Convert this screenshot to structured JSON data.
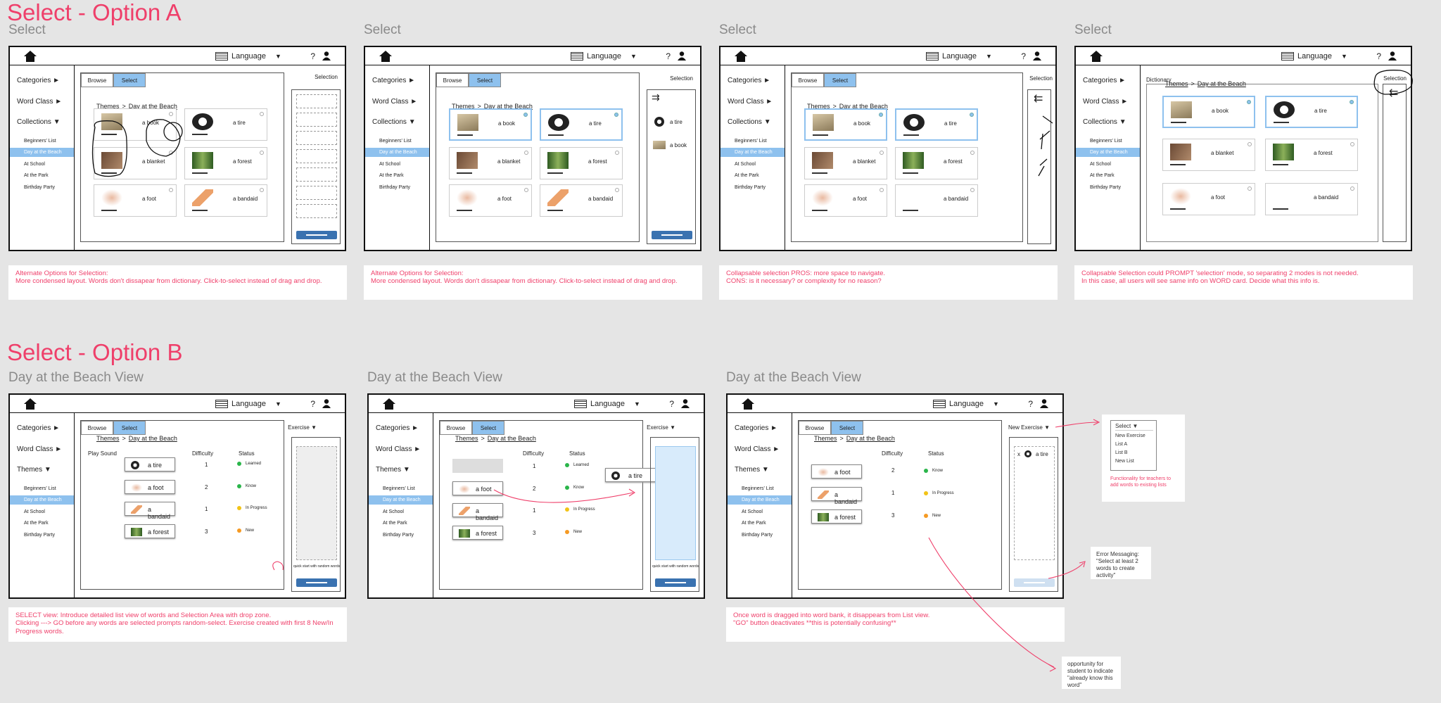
{
  "headings": {
    "a": "Select - Option A",
    "b": "Select - Option B"
  },
  "frame_labels": [
    "Select",
    "Select",
    "Select",
    "Select",
    "Day at the Beach View",
    "Day at the Beach View",
    "Day at the Beach View"
  ],
  "header": {
    "language": "Language",
    "help": "?"
  },
  "sidebar": {
    "categories": "Categories",
    "word_class": "Word Class",
    "collections": "Collections",
    "themes": "Themes",
    "items": [
      "Beginners' List",
      "Day at the Beach",
      "At School",
      "At the Park",
      "Birthday Party"
    ]
  },
  "tabs": {
    "browse": "Browse",
    "select": "Select"
  },
  "crumb": {
    "themes": "Themes",
    "sep": ">",
    "page": "Day at the Beach"
  },
  "words": {
    "book": "a book",
    "tire": "a tire",
    "blanket": "a blanket",
    "forest": "a forest",
    "foot": "a foot",
    "bandaid": "a bandaid"
  },
  "selection": "Selection",
  "dictionary": "Dictionary",
  "list": {
    "play_sound": "Play Sound",
    "difficulty": "Difficulty",
    "status": "Status",
    "exercise": "Exercise",
    "new_exercise": "New Exercise",
    "quick_start": "quick start with random words",
    "x": "x"
  },
  "diff": {
    "tire": "1",
    "foot": "2",
    "bandaid": "1",
    "forest": "3"
  },
  "status": {
    "learned": "Learned",
    "know": "Know",
    "in_progress": "In Progress",
    "new": "New"
  },
  "b3_diff": {
    "foot": "2",
    "bandaid": "1",
    "forest": "3"
  },
  "notes": [
    {
      "title": "Alternate Options for Selection:",
      "body": "More condensed layout. Words don't dissapear from dictionary. Click-to-select instead of drag and drop."
    },
    {
      "title": "Alternate Options for Selection:",
      "body": "More condensed layout. Words don't dissapear from dictionary. Click-to-select instead of drag and drop."
    },
    {
      "title": "Collapsable selection PROS: more space to navigate.",
      "body": "CONS: is it necessary? or complexity for no reason?"
    },
    {
      "title": "Collapsable Selection could PROMPT 'selection' mode, so separating 2 modes is not needed.",
      "body": "In this case, all users will see same info on WORD card. Decide what this info is."
    },
    {
      "title": "SELECT view: Introduce detailed list view of words and Selection Area with drop zone.",
      "body": "Clicking ---> GO before any words are selected prompts random-select. Exercise created with first 8 New/In Progress words."
    },
    {
      "title": "Once word is dragged into word bank, it disappears from List view.",
      "body": "\"GO\" button deactivates **this is potentially confusing**"
    }
  ],
  "dropdown": {
    "head": "Select",
    "items": [
      "New Exercise",
      "List A",
      "List B",
      "New List"
    ],
    "caption": "Functionality for teachers to add words to existing lists"
  },
  "error_msg": "Error Messaging: \"Select at least 2 words to create activity\"",
  "opportunity": "opportunity for student to indicate \"already know this word\"",
  "colors": {
    "accent": "#ef3f6a",
    "select_blue": "#8ec1ee",
    "go_blue": "#3a72b0",
    "learned": "#2ab54a",
    "in_progress": "#f2c316",
    "new": "#f59a23"
  }
}
